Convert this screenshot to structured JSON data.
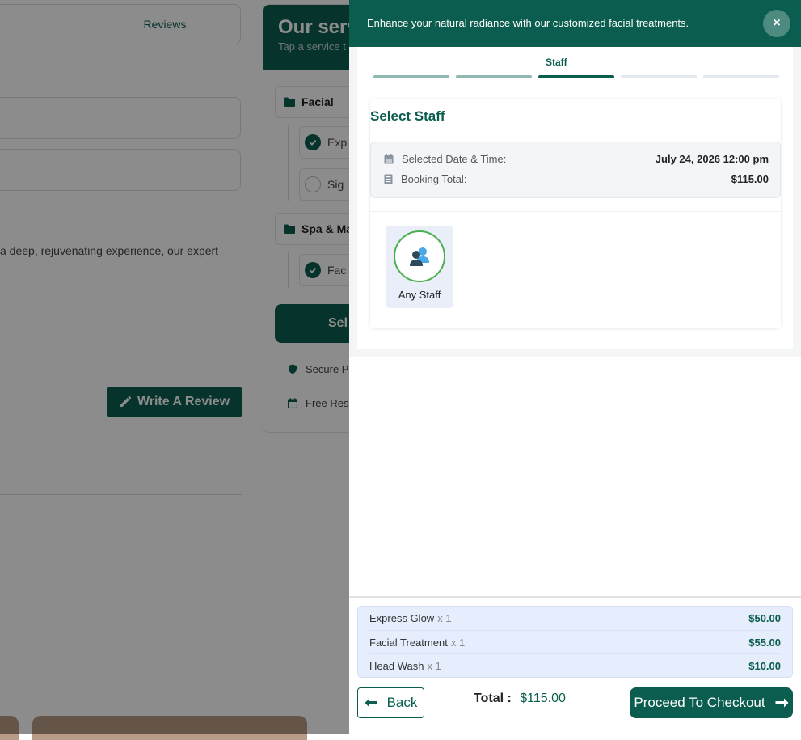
{
  "background": {
    "reviews_tab": "Reviews",
    "description_fragment": "a deep, rejuvenating experience, our expert",
    "write_review_label": "Write A Review",
    "services": {
      "title": "Our serv",
      "subtitle": "Tap a service t",
      "categories": [
        {
          "name": "Facial",
          "items": [
            {
              "label": "Exp",
              "checked": true
            },
            {
              "label": "Sig",
              "checked": false
            }
          ]
        },
        {
          "name": "Spa & Mas",
          "items": [
            {
              "label": "Fac",
              "checked": true
            }
          ]
        }
      ],
      "select_label": "Sel",
      "features": [
        "Secure P",
        "Free Rese"
      ]
    }
  },
  "drawer": {
    "header_text": "Enhance your natural radiance with our customized facial treatments.",
    "close_symbol": "×",
    "current_step_label": "Staff",
    "steps": [
      {
        "state": "done"
      },
      {
        "state": "done"
      },
      {
        "state": "active"
      },
      {
        "state": "pending"
      },
      {
        "state": "pending"
      }
    ],
    "card_title": "Select Staff",
    "summary": {
      "date_label": "Selected Date & Time:",
      "date_value": "July 24, 2026 12:00 pm",
      "total_label": "Booking Total:",
      "total_value": "$115.00"
    },
    "staff_options": [
      {
        "name": "Any Staff",
        "selected": true
      }
    ]
  },
  "footer": {
    "items": [
      {
        "name": "Express Glow",
        "qty": "x 1",
        "price": "$50.00"
      },
      {
        "name": "Facial Treatment",
        "qty": "x 1",
        "price": "$55.00"
      },
      {
        "name": "Head Wash",
        "qty": "x 1",
        "price": "$10.00"
      }
    ],
    "back_label": "Back",
    "total_label": "Total :",
    "total_value": "$115.00",
    "checkout_label": "Proceed To Checkout"
  },
  "colors": {
    "brand": "#0b5d4f",
    "accent_green": "#4caf50",
    "items_bg": "#e6eefd"
  }
}
